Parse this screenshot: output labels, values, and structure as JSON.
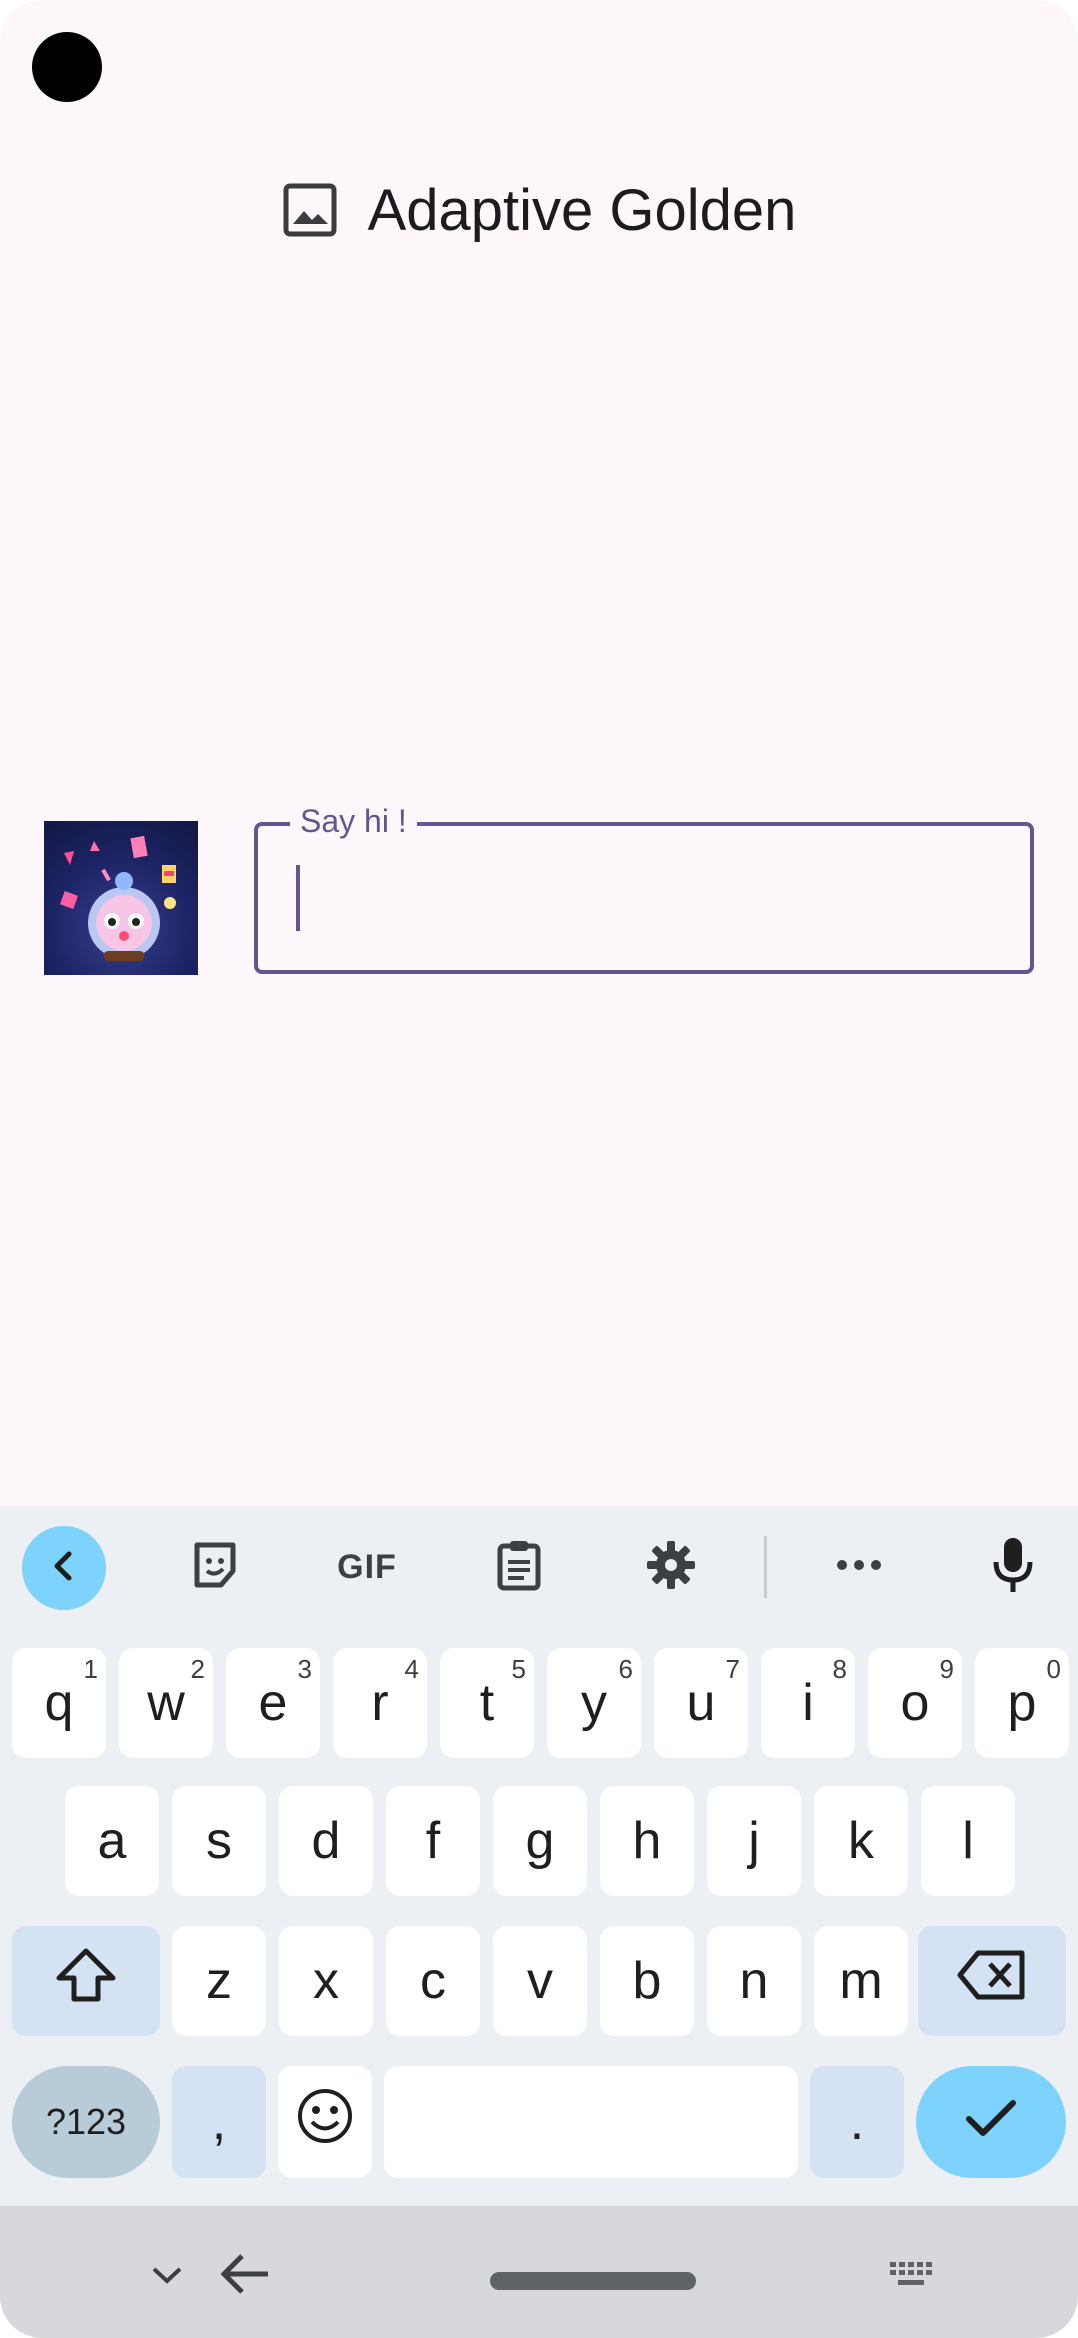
{
  "app": {
    "title": "Adaptive Golden",
    "title_icon": "image-icon"
  },
  "input": {
    "label": "Say hi !",
    "value": "",
    "accent_color": "#65558f"
  },
  "avatar": {
    "icon": "avatar-image"
  },
  "keyboard": {
    "toolbar": {
      "back_icon": "chevron-left-icon",
      "sticker_icon": "sticker-icon",
      "gif_label": "GIF",
      "clipboard_icon": "clipboard-icon",
      "settings_icon": "gear-icon",
      "more_icon": "more-horizontal-icon",
      "mic_icon": "mic-icon"
    },
    "row1": [
      {
        "key": "q",
        "hint": "1"
      },
      {
        "key": "w",
        "hint": "2"
      },
      {
        "key": "e",
        "hint": "3"
      },
      {
        "key": "r",
        "hint": "4"
      },
      {
        "key": "t",
        "hint": "5"
      },
      {
        "key": "y",
        "hint": "6"
      },
      {
        "key": "u",
        "hint": "7"
      },
      {
        "key": "i",
        "hint": "8"
      },
      {
        "key": "o",
        "hint": "9"
      },
      {
        "key": "p",
        "hint": "0"
      }
    ],
    "row2": [
      "a",
      "s",
      "d",
      "f",
      "g",
      "h",
      "j",
      "k",
      "l"
    ],
    "row3": [
      "z",
      "x",
      "c",
      "v",
      "b",
      "n",
      "m"
    ],
    "row4": {
      "symbols_label": "?123",
      "comma_label": ",",
      "period_label": "."
    },
    "colors": {
      "accent": "#7dd3fc",
      "modifier": "#d3e3f3"
    }
  },
  "navbar": {
    "hide_keyboard_icon": "chevron-down-icon",
    "back_icon": "arrow-left-icon",
    "keyboard_switch_icon": "keyboard-icon"
  }
}
